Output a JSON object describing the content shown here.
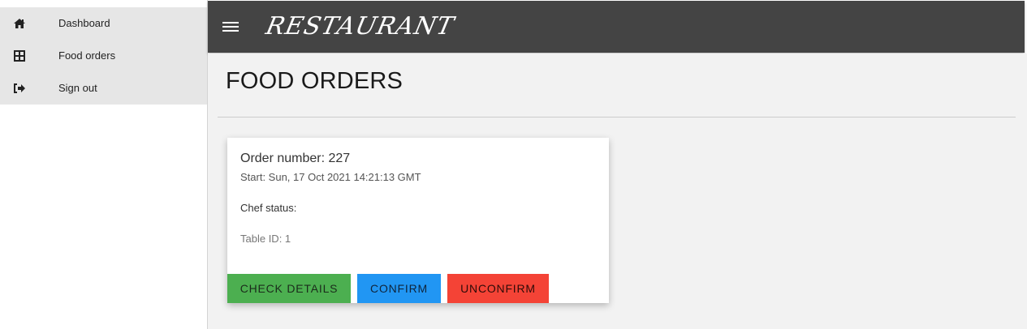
{
  "sidebar": {
    "items": [
      {
        "label": "Dashboard",
        "icon": "home-icon"
      },
      {
        "label": "Food orders",
        "icon": "grid-icon"
      },
      {
        "label": "Sign out",
        "icon": "sign-out-icon"
      }
    ]
  },
  "topbar": {
    "menu_icon": "hamburger-menu-icon",
    "brand": "RESTAURANT",
    "background": "#444444"
  },
  "main": {
    "title": "FOOD ORDERS",
    "orders": [
      {
        "order_number": "Order number: 227",
        "start": "Start: Sun, 17 Oct 2021 14:21:13 GMT",
        "chef_status": "Chef status:",
        "table_id": "Table ID: 1",
        "buttons": {
          "details": "CHECK DETAILS",
          "confirm": "CONFIRM",
          "unconfirm": "UNCONFIRM"
        }
      }
    ]
  },
  "colors": {
    "details_button": "#4caf50",
    "confirm_button": "#2196f3",
    "unconfirm_button": "#f44336",
    "sidebar_background": "#e6e6e6",
    "main_background": "#f2f2f2"
  }
}
